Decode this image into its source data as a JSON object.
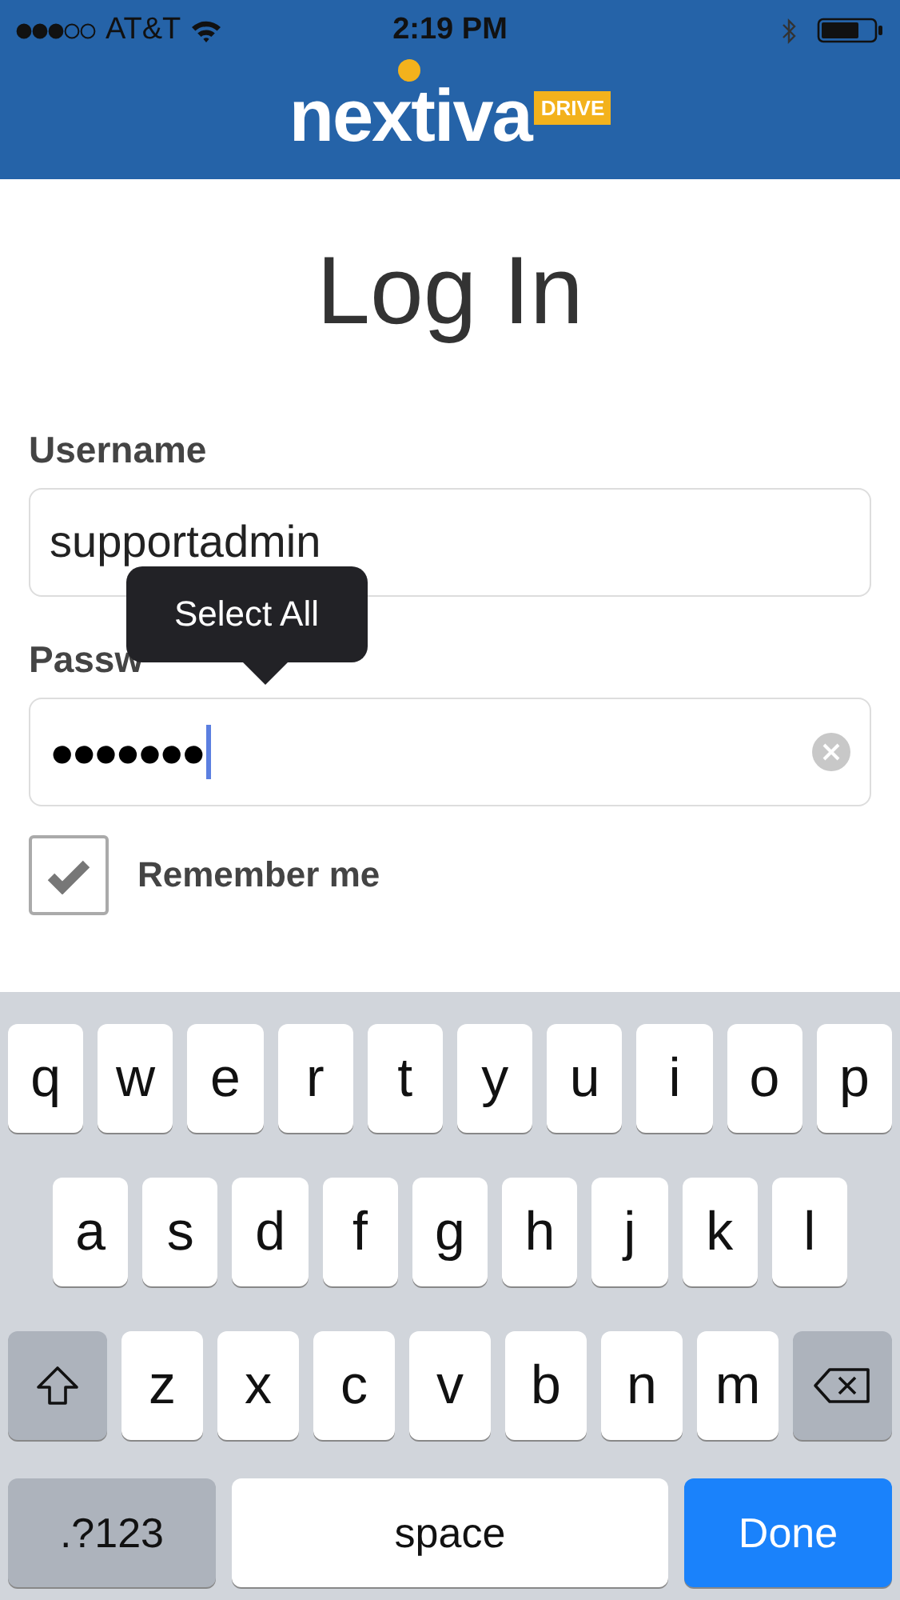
{
  "status_bar": {
    "carrier": "AT&T",
    "time": "2:19 PM"
  },
  "logo": {
    "wordmark": "nextiva",
    "badge": "DRIVE"
  },
  "title": "Log In",
  "fields": [
    {
      "label": "Username",
      "value": "supportadmin",
      "kind": "text",
      "focused": false
    },
    {
      "label": "Passw",
      "value": "●●●●●●●",
      "kind": "password",
      "focused": true
    }
  ],
  "tooltip": "Select All",
  "remember": {
    "label": "Remember me",
    "checked": true
  },
  "keyboard": [
    {
      "keys": [
        {
          "label": "q",
          "kind": "letter"
        },
        {
          "label": "w",
          "kind": "letter"
        },
        {
          "label": "e",
          "kind": "letter"
        },
        {
          "label": "r",
          "kind": "letter"
        },
        {
          "label": "t",
          "kind": "letter"
        },
        {
          "label": "y",
          "kind": "letter"
        },
        {
          "label": "u",
          "kind": "letter"
        },
        {
          "label": "i",
          "kind": "letter"
        },
        {
          "label": "o",
          "kind": "letter"
        },
        {
          "label": "p",
          "kind": "letter"
        }
      ]
    },
    {
      "keys": [
        {
          "label": "a",
          "kind": "letter"
        },
        {
          "label": "s",
          "kind": "letter"
        },
        {
          "label": "d",
          "kind": "letter"
        },
        {
          "label": "f",
          "kind": "letter"
        },
        {
          "label": "g",
          "kind": "letter"
        },
        {
          "label": "h",
          "kind": "letter"
        },
        {
          "label": "j",
          "kind": "letter"
        },
        {
          "label": "k",
          "kind": "letter"
        },
        {
          "label": "l",
          "kind": "letter"
        }
      ]
    },
    {
      "keys": [
        {
          "kind": "shift"
        },
        {
          "label": "z",
          "kind": "letter"
        },
        {
          "label": "x",
          "kind": "letter"
        },
        {
          "label": "c",
          "kind": "letter"
        },
        {
          "label": "v",
          "kind": "letter"
        },
        {
          "label": "b",
          "kind": "letter"
        },
        {
          "label": "n",
          "kind": "letter"
        },
        {
          "label": "m",
          "kind": "letter"
        },
        {
          "kind": "delete"
        }
      ]
    },
    {
      "keys": [
        {
          "label": ".?123",
          "kind": "mode"
        },
        {
          "label": "space",
          "kind": "space"
        },
        {
          "label": "Done",
          "kind": "done"
        }
      ]
    }
  ]
}
